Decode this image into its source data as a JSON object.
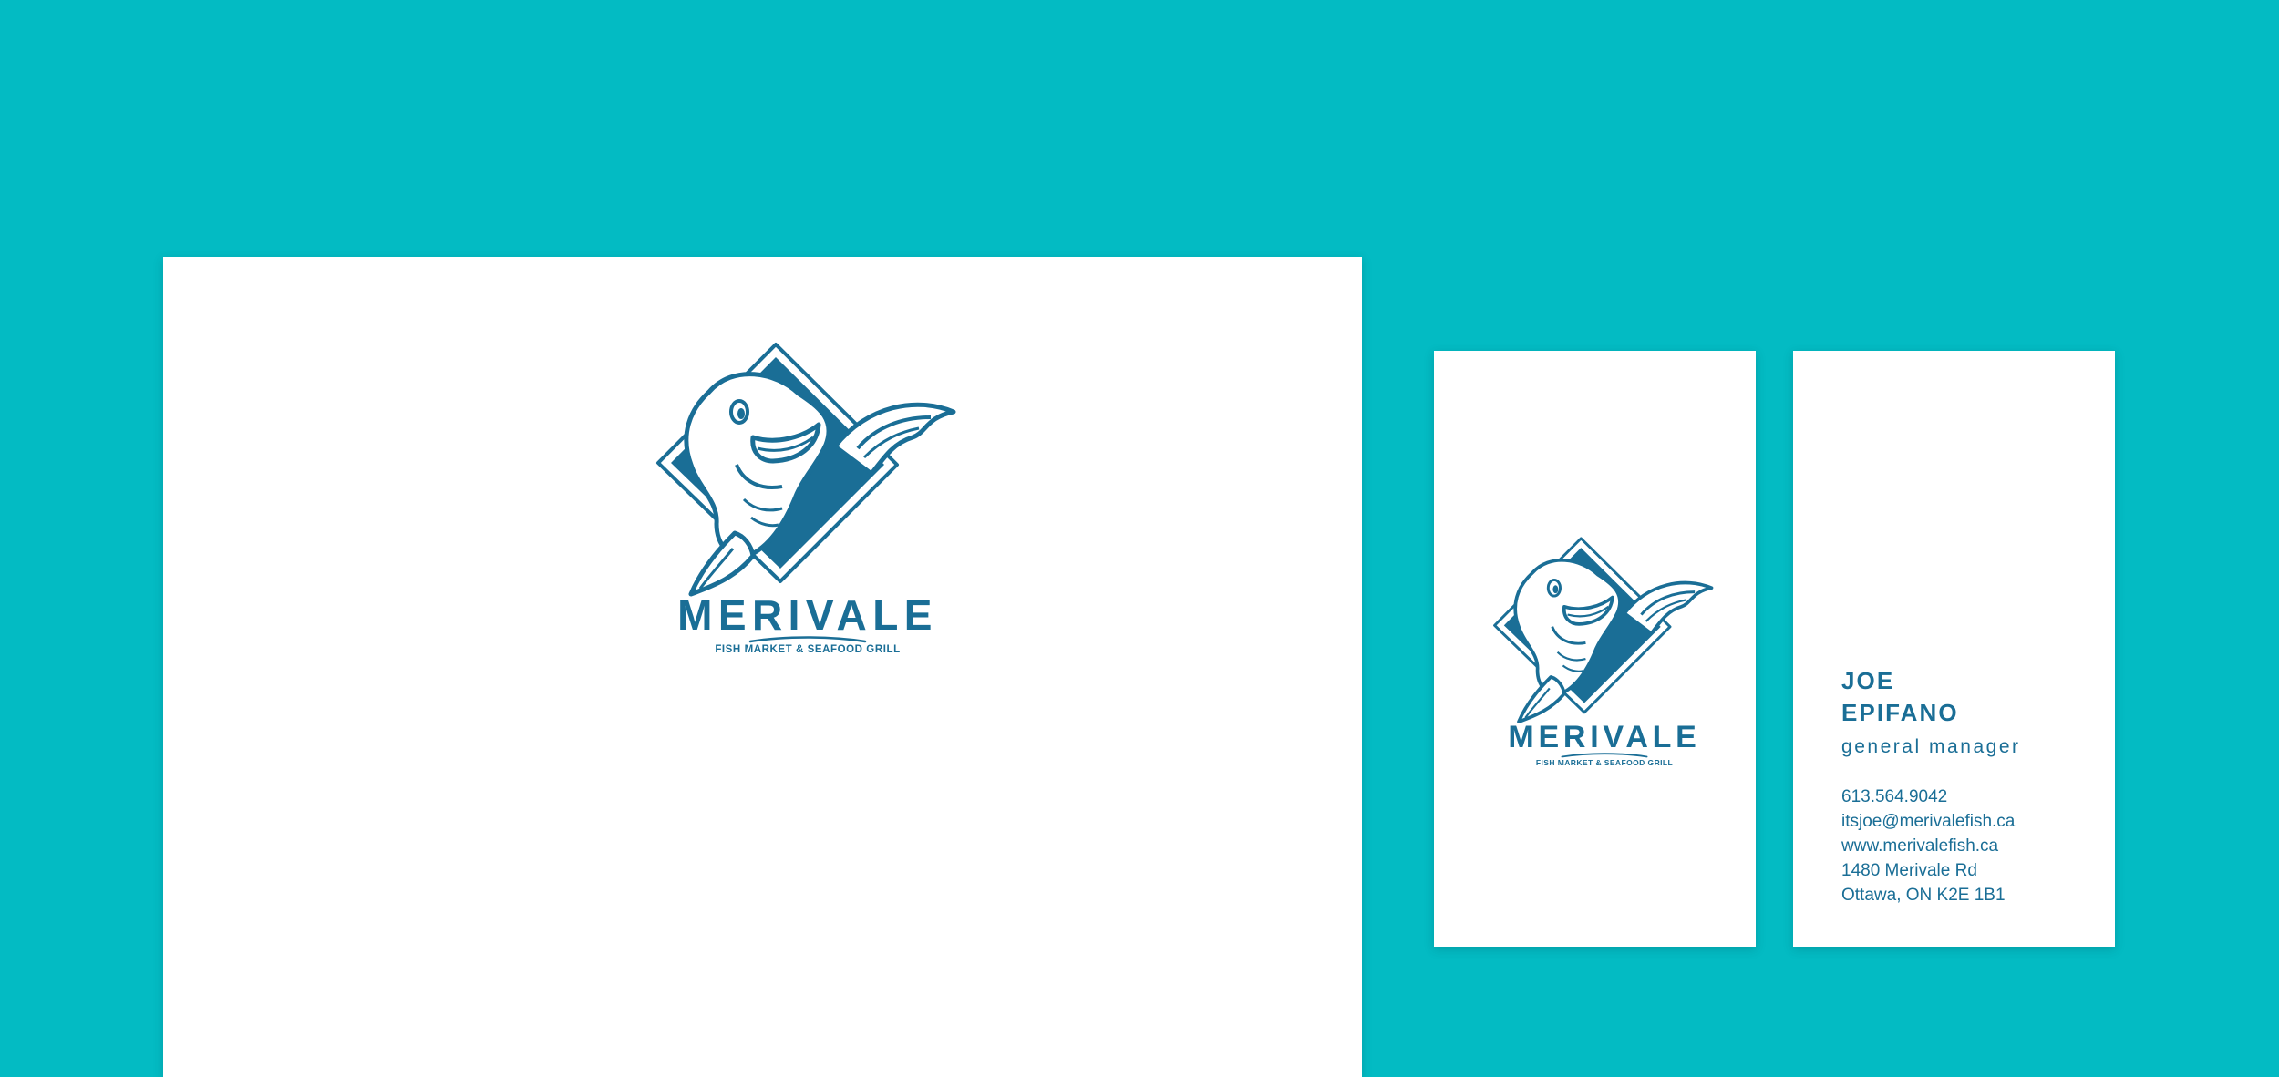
{
  "brand": {
    "name": "MERIVALE",
    "tagline": "FISH MARKET & SEAFOOD GRILL",
    "primary_color": "#1a6e96",
    "background_color": "#03bbc3",
    "logo_icon": "fish-mascot-diamond-icon"
  },
  "business_card": {
    "name_line1": "JOE",
    "name_line2": "EPIFANO",
    "title": "general manager",
    "phone": "613.564.9042",
    "email": "itsjoe@merivalefish.ca",
    "website": "www.merivalefish.ca",
    "address_line1": "1480 Merivale Rd",
    "address_line2": "Ottawa, ON K2E 1B1"
  }
}
